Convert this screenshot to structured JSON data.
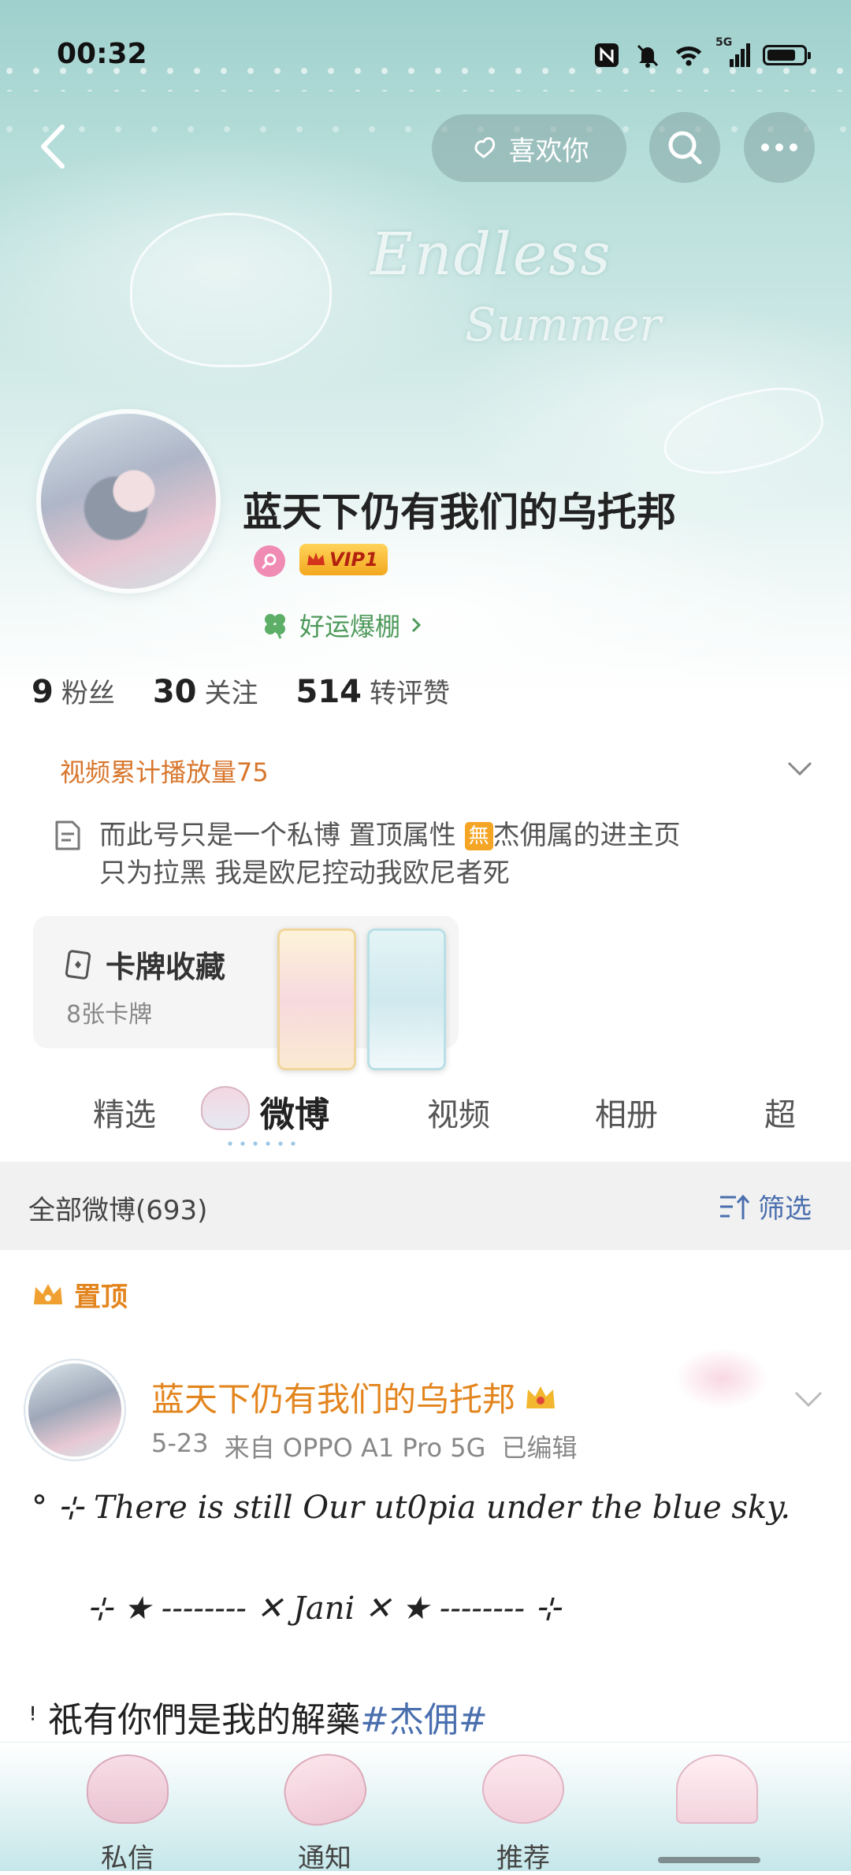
{
  "status_bar": {
    "time": "00:32",
    "network": "5G"
  },
  "top_bar": {
    "like_label": "喜欢你"
  },
  "profile": {
    "nickname": "蓝天下仍有我们的乌托邦",
    "vip_label": "VIP1",
    "lucky_label": "好运爆棚",
    "banner_text_1": "Endless",
    "banner_text_2": "Summer"
  },
  "stats": [
    {
      "num": "9",
      "label": "粉丝"
    },
    {
      "num": "30",
      "label": "关注"
    },
    {
      "num": "514",
      "label": "转评赞"
    }
  ],
  "video_plays": "视频累计播放量75",
  "bio": {
    "line1_a": "而此号只是一个私博 置顶属性 ",
    "badge": "無",
    "line1_b": "杰佣属的进主页",
    "line2": "只为拉黑 我是欧尼控动我欧尼者死"
  },
  "card_collection": {
    "title": "卡牌收藏",
    "count": "8张卡牌"
  },
  "tabs": [
    "精选",
    "微博",
    "视频",
    "相册",
    "超"
  ],
  "active_tab": "微博",
  "filter_bar": {
    "all_posts": "全部微博(693)",
    "filter_label": "筛选"
  },
  "pinned_label": "置顶",
  "post": {
    "author": "蓝天下仍有我们的乌托邦",
    "date": "5-23",
    "source": "来自 OPPO A1 Pro 5G",
    "edited": "已编辑",
    "line1": "° ⊹ There is still Our ut0pia under the blue sky.",
    "line2": "⊹ ★ -------- ✕ Jani ✕ ★ -------- ⊹",
    "line3_text": "ꜝ 祇有你們是我的解藥",
    "line3_tag": "#杰佣#"
  },
  "bottom_nav": [
    "私信",
    "通知",
    "推荐"
  ],
  "colors": {
    "accent_orange": "#e3851e",
    "link_blue": "#4a6fae",
    "vip_gold": "#f2a81e",
    "lucky_green": "#4e9a5b"
  }
}
